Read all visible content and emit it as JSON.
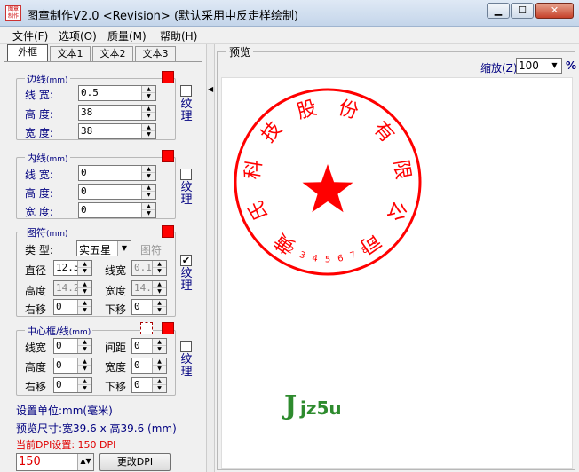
{
  "window": {
    "title": "图章制作V2.0 <Revision> (默认采用中反走样绘制)",
    "app_icon_text": "图章制作",
    "min_glyph": "▁",
    "max_glyph": "☐",
    "close_glyph": "✕"
  },
  "menu": [
    "文件(F)",
    "选项(O)",
    "质量(M)",
    "帮助(H)"
  ],
  "tabs": [
    "外框",
    "文本1",
    "文本2",
    "文本3"
  ],
  "border_group": {
    "title": "边线",
    "unit": "(mm)",
    "line_width_label": "线  宽:",
    "height_label": "高  度:",
    "width_label": "宽  度:",
    "line_width": "0.5",
    "height": "38",
    "width": "38",
    "texture_label": "纹理",
    "texture_checked": false
  },
  "inner_group": {
    "title": "内线",
    "unit": "(mm)",
    "line_width_label": "线  宽:",
    "height_label": "高  度:",
    "width_label": "宽  度:",
    "line_width": "0",
    "height": "0",
    "width": "0",
    "texture_label": "纹理",
    "texture_checked": false
  },
  "symbol_group": {
    "title": "图符",
    "unit": "(mm)",
    "type_label": "类  型:",
    "type_value": "实五星",
    "image_button": "图符",
    "diameter_label": "直径",
    "diameter": "12.5",
    "line_width_label": "线宽",
    "line_width": "0.1",
    "height_label": "高度",
    "height": "14.2",
    "width_label": "宽度",
    "width": "14.2",
    "right_label": "右移",
    "right": "0",
    "down_label": "下移",
    "down": "0",
    "texture_label": "纹理",
    "texture_checked": true,
    "texture_check_glyph": "✔"
  },
  "center_group": {
    "title": "中心框/线",
    "unit": "(mm)",
    "line_width_label": "线宽",
    "line_width": "0",
    "spacing_label": "间距",
    "spacing": "0",
    "height_label": "高度",
    "height": "0",
    "width_label": "宽度",
    "width": "0",
    "right_label": "右移",
    "right": "0",
    "down_label": "下移",
    "down": "0",
    "texture_label": "纹理",
    "texture_checked": false
  },
  "info": {
    "unit_text": "设置单位:mm(毫米)",
    "preview_size": "预览尺寸:宽39.6 x 高39.6 (mm)",
    "dpi_text": "当前DPI设置: 150 DPI",
    "dpi_value": "150",
    "change_dpi_button": "更改DPI"
  },
  "preview": {
    "title": "预览",
    "zoom_label": "缩放(Z)",
    "zoom_value": "100",
    "zoom_pct": "%",
    "stamp_text": "黄氏科技股份有限公司",
    "stamp_code": "123456789",
    "stamp_color": "#ff0000"
  },
  "watermark": {
    "j": "J",
    "text": "jz5u"
  },
  "colors": {
    "accent_red": "#ff0000",
    "label_blue": "#000080"
  }
}
